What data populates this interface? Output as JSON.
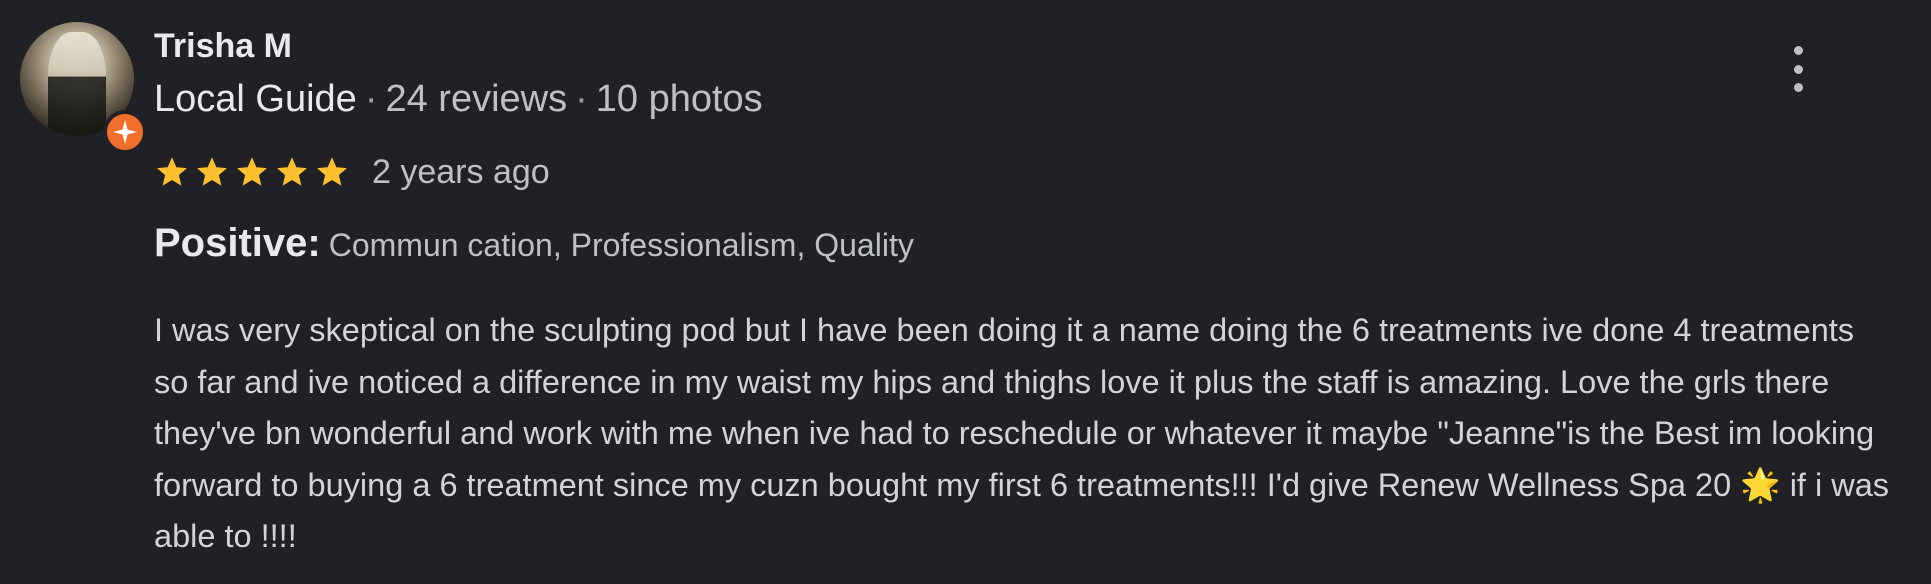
{
  "review": {
    "author": "Trisha M",
    "author_level": "Local Guide",
    "reviews_count": "24 reviews",
    "photos_count": "10 photos",
    "separator": "·",
    "rating": 5,
    "rating_max": 5,
    "time": "2 years ago",
    "positive_label": "Positive:",
    "positive_items": "Commun cation, Professionalism, Quality",
    "body": "I was very skeptical on the sculpting pod but I have been doing it a name doing the 6 treatments ive done 4 treatments so far and ive noticed a difference in my waist my hips and thighs love it plus the staff is amazing. Love the grls there they've bn wonderful and work with me when ive had to reschedule or whatever it maybe \"Jeanne\"is the Best im looking forward to buying a 6 treatment since my cuzn bought my first 6 treatments!!! I'd give Renew Wellness Spa 20 🌟 if i was able to !!!!"
  },
  "icons": {
    "avatar": "avatar",
    "badge": "local-guide-badge-icon",
    "menu": "more-vert-icon",
    "star": "star-icon"
  },
  "colors": {
    "background": "#202124",
    "star": "#fbc02d",
    "badge": "#f26e2b",
    "text_primary": "#e8eaed",
    "text_secondary": "#bdc1c6"
  }
}
